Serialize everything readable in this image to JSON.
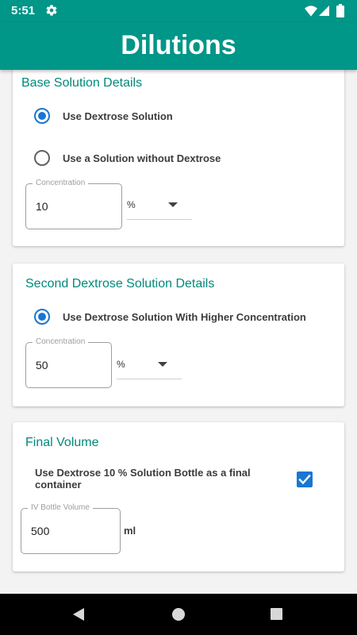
{
  "status_bar": {
    "time": "5:51",
    "icons": [
      "gear-icon",
      "wifi-icon",
      "signal-icon",
      "battery-icon"
    ]
  },
  "app_bar": {
    "title": "Dilutions"
  },
  "base_solution": {
    "title": "Base Solution Details",
    "options": [
      {
        "label": "Use Dextrose Solution",
        "selected": true
      },
      {
        "label": "Use a Solution without Dextrose",
        "selected": false
      }
    ],
    "concentration": {
      "label": "Concentration",
      "value": "10"
    },
    "unit": {
      "selected": "%"
    }
  },
  "second_solution": {
    "title": "Second Dextrose Solution Details",
    "option": {
      "label": "Use Dextrose Solution With Higher Concentration",
      "selected": true
    },
    "concentration": {
      "label": "Concentration",
      "value": "50"
    },
    "unit": {
      "selected": "%"
    }
  },
  "final_volume": {
    "title": "Final Volume",
    "container_checkbox": {
      "label": "Use Dextrose 10 % Solution Bottle as a final container",
      "checked": true
    },
    "bottle_volume": {
      "label": "IV Bottle Volume",
      "value": "500",
      "unit": "ml"
    }
  },
  "colors": {
    "primary": "#009688",
    "section_title": "#00897b",
    "accent": "#1976d2",
    "background": "#f3f3f3"
  },
  "nav_bar": {
    "icons": [
      "back-icon",
      "home-icon",
      "recent-apps-icon"
    ]
  }
}
